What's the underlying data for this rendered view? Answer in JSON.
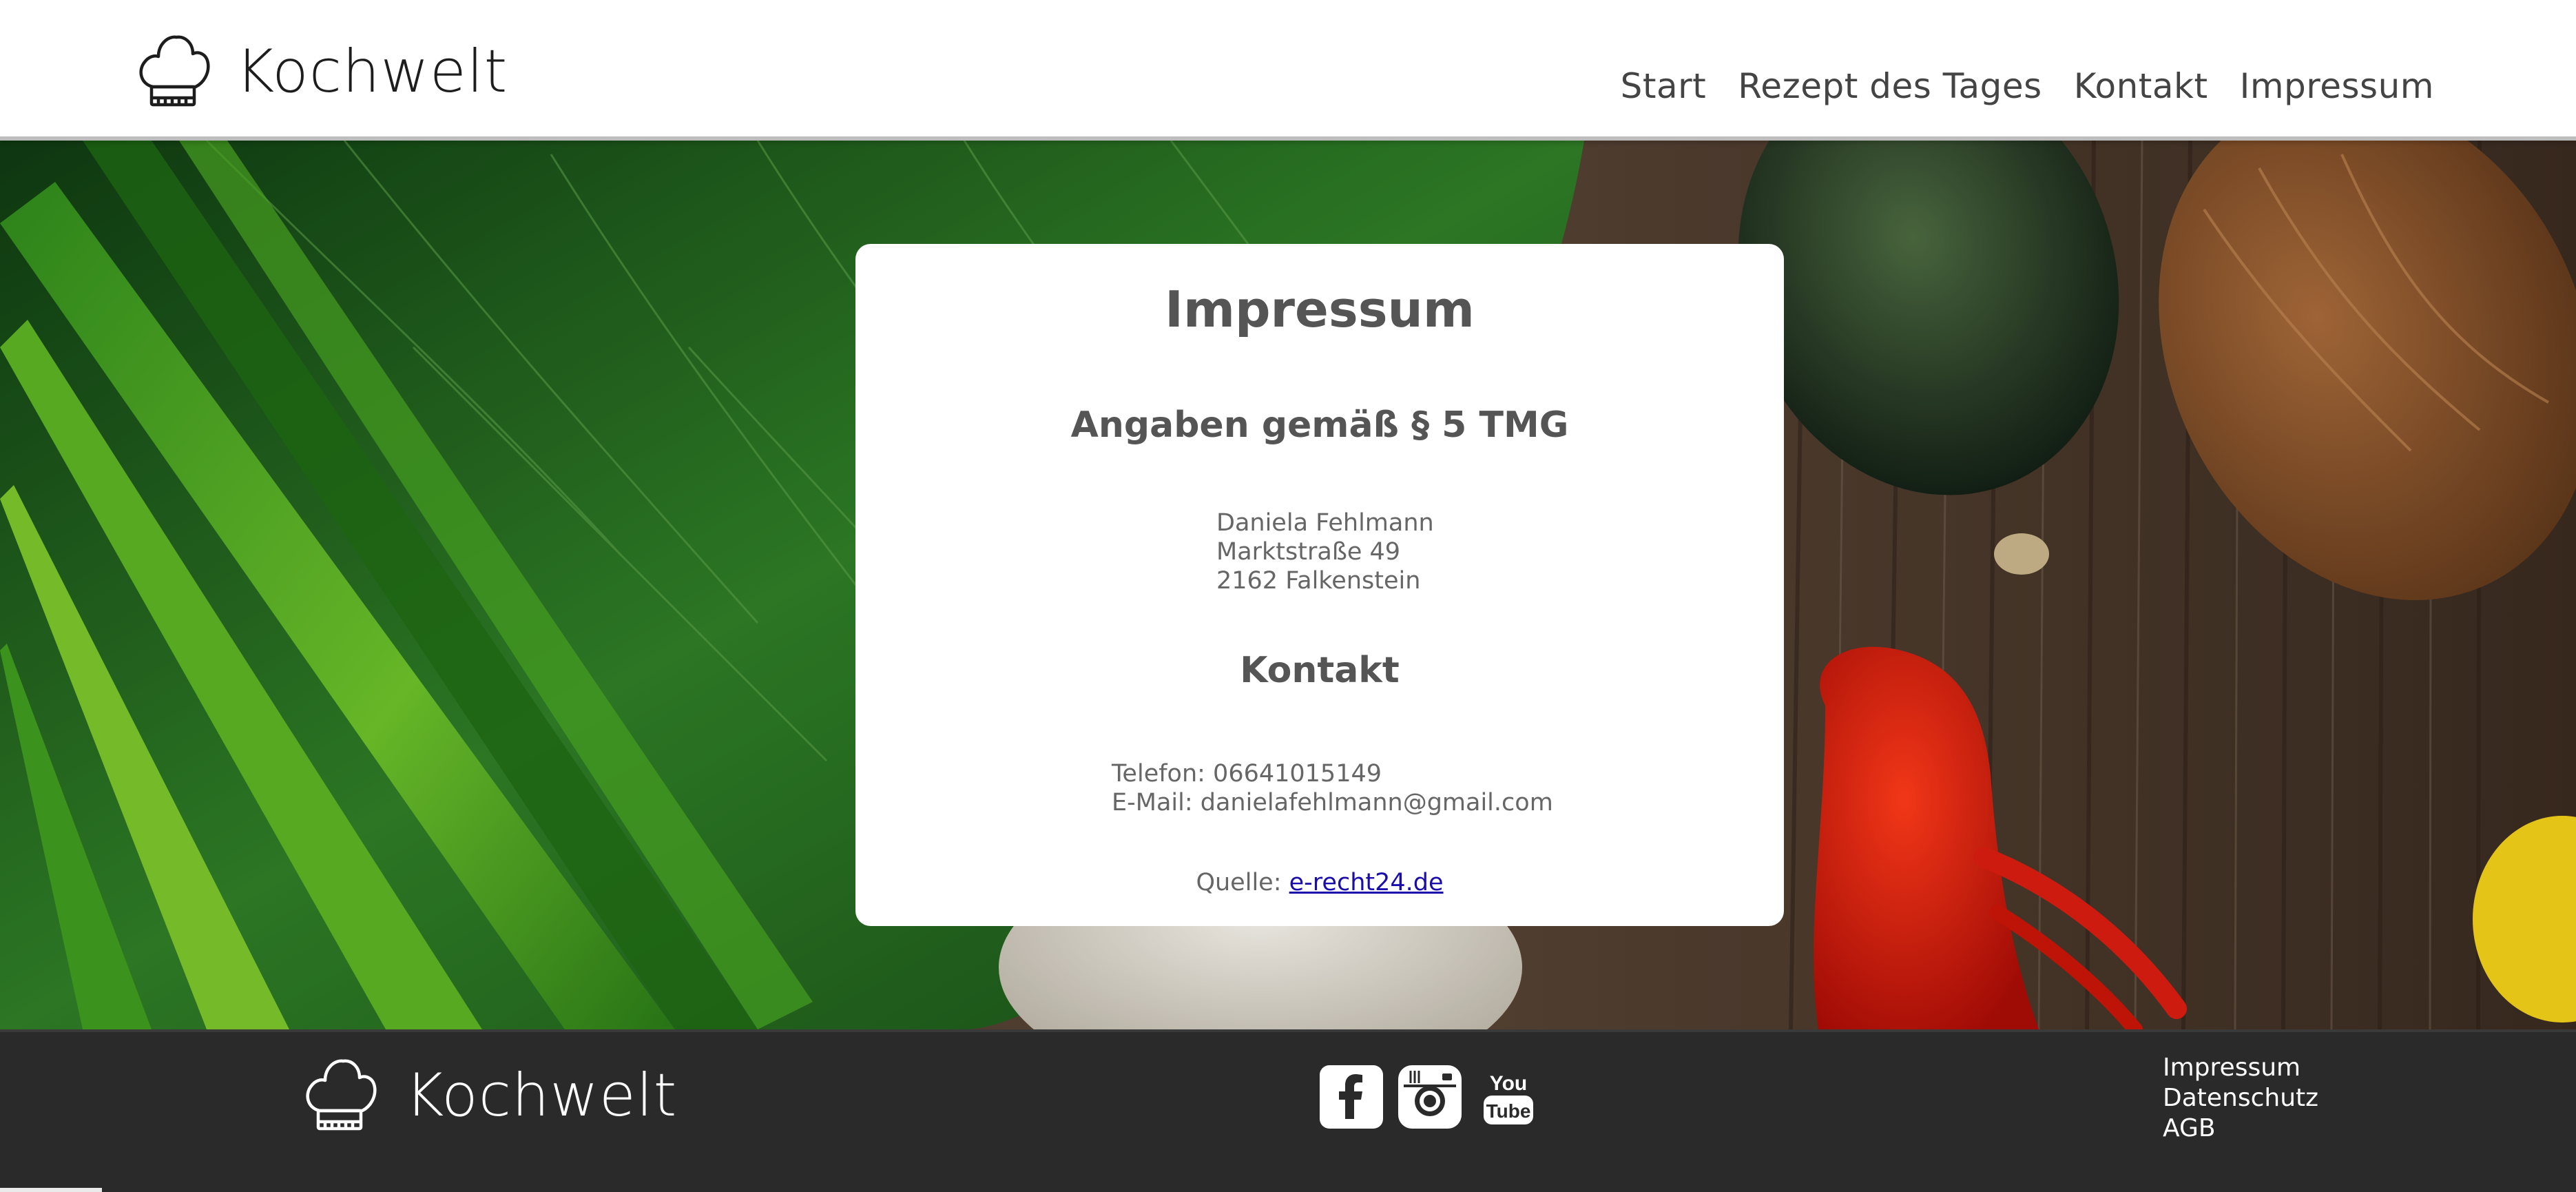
{
  "brand": {
    "name": "Kochwelt",
    "logo_icon": "chef-hat-icon"
  },
  "nav": {
    "items": [
      {
        "label": "Start"
      },
      {
        "label": "Rezept des Tages"
      },
      {
        "label": "Kontakt"
      },
      {
        "label": "Impressum"
      }
    ]
  },
  "content": {
    "title": "Impressum",
    "section1_heading": "Angaben gemäß § 5 TMG",
    "address": {
      "name": "Daniela Fehlmann",
      "street": "Marktstraße 49",
      "city": "2162 Falkenstein"
    },
    "section2_heading": "Kontakt",
    "contact": {
      "phone": "Telefon: 06641015149",
      "email": "E-Mail: danielafehlmann@gmail.com"
    },
    "source_label": "Quelle:",
    "source_link": "e-recht24.de"
  },
  "footer": {
    "brand_name": "Kochwelt",
    "social": [
      {
        "name": "facebook-icon"
      },
      {
        "name": "instagram-icon"
      },
      {
        "name": "youtube-icon",
        "label_top": "You",
        "label_bottom": "Tube"
      }
    ],
    "links": [
      {
        "label": "Impressum"
      },
      {
        "label": "Datenschutz"
      },
      {
        "label": "AGB"
      }
    ]
  },
  "colors": {
    "footer_bg": "#2a2a2a",
    "link_blue": "#1a0dab",
    "heading_gray": "#555555"
  }
}
